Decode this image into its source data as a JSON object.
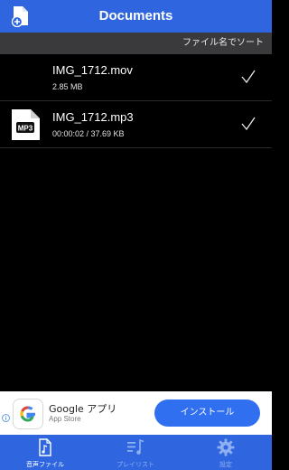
{
  "header": {
    "title": "Documents",
    "add_icon": "add-document-icon"
  },
  "sortbar": {
    "label": "ファイル名でソート"
  },
  "files": [
    {
      "name": "IMG_1712.mov",
      "meta": "2.85 MB",
      "thumb": "",
      "checked": true
    },
    {
      "name": "IMG_1712.mp3",
      "meta": "00:00:02 / 37.69 KB",
      "thumb": "MP3",
      "checked": true
    }
  ],
  "ad": {
    "app_name": "Google アプリ",
    "app_store": "App Store",
    "install_label": "インストール"
  },
  "tabs": [
    {
      "label": "音声ファイル",
      "icon": "audio-file-icon",
      "active": true
    },
    {
      "label": "プレイリスト",
      "icon": "playlist-icon",
      "active": false
    },
    {
      "label": "設定",
      "icon": "gear-icon",
      "active": false
    }
  ],
  "colors": {
    "accent": "#2f66e0",
    "install_button": "#2f6ff0",
    "sortbar": "#3a3a3c"
  }
}
